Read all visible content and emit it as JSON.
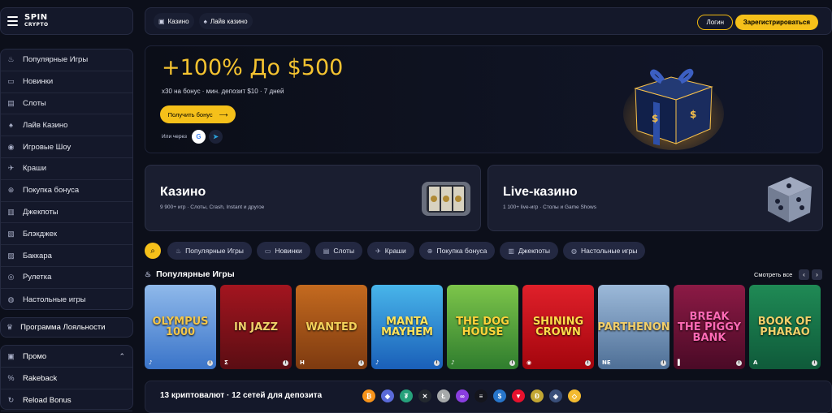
{
  "logo": {
    "line1": "SPIN",
    "line2": "CRYPTO"
  },
  "sidebar": {
    "items": [
      {
        "label": "Популярные Игры",
        "icon": "fire-icon",
        "glyph": "♨"
      },
      {
        "label": "Новинки",
        "icon": "new-icon",
        "glyph": "▭"
      },
      {
        "label": "Слоты",
        "icon": "slots-icon",
        "glyph": "▤"
      },
      {
        "label": "Лайв Казино",
        "icon": "live-icon",
        "glyph": "♠"
      },
      {
        "label": "Игровые Шоу",
        "icon": "show-icon",
        "glyph": "◉"
      },
      {
        "label": "Краши",
        "icon": "plane-icon",
        "glyph": "✈"
      },
      {
        "label": "Покупка бонуса",
        "icon": "bonus-icon",
        "glyph": "⊕"
      },
      {
        "label": "Джекпоты",
        "icon": "jackpot-icon",
        "glyph": "▥"
      },
      {
        "label": "Блэкджек",
        "icon": "cards-icon",
        "glyph": "▧"
      },
      {
        "label": "Баккара",
        "icon": "baccarat-icon",
        "glyph": "▨"
      },
      {
        "label": "Рулетка",
        "icon": "roulette-icon",
        "glyph": "◎"
      },
      {
        "label": "Настольные игры",
        "icon": "table-icon",
        "glyph": "◍"
      }
    ],
    "loyalty": {
      "label": "Программа Лояльности",
      "icon": "crown-icon",
      "glyph": "♛"
    },
    "promo": [
      {
        "label": "Промо",
        "icon": "gift-icon",
        "glyph": "▣"
      },
      {
        "label": "Rakeback",
        "icon": "percent-icon",
        "glyph": "%"
      },
      {
        "label": "Reload Bonus",
        "icon": "reload-icon",
        "glyph": "↻"
      }
    ]
  },
  "topbar": {
    "tabs": [
      {
        "label": "Казино",
        "icon": "casino-icon",
        "glyph": "▣"
      },
      {
        "label": "Лайв казино",
        "icon": "live-casino-icon",
        "glyph": "♠"
      }
    ],
    "login_label": "Логин",
    "register_label": "Зарегистрироваться"
  },
  "hero": {
    "title": "+100% До $500",
    "subtitle": "x30 на бонус · мин. депозит $10 · 7 дней",
    "button_label": "Получить бонус",
    "button_arrow": "⟶",
    "or_label": "Или через",
    "google_glyph": "G",
    "telegram_glyph": "➤"
  },
  "categories": [
    {
      "title": "Казино",
      "subtitle": "9 900+ игр · Слоты, Crash, Instant и другое"
    },
    {
      "title": "Live-казино",
      "subtitle": "1 100+ live-игр · Столы и Game Shows"
    }
  ],
  "filters": {
    "search_glyph": "⌕",
    "chips": [
      {
        "label": "Популярные Игры",
        "glyph": "♨"
      },
      {
        "label": "Новинки",
        "glyph": "▭"
      },
      {
        "label": "Слоты",
        "glyph": "▤"
      },
      {
        "label": "Краши",
        "glyph": "✈"
      },
      {
        "label": "Покупка бонуса",
        "glyph": "⊕"
      },
      {
        "label": "Джекпоты",
        "glyph": "▥"
      },
      {
        "label": "Настольные игры",
        "glyph": "◍"
      }
    ]
  },
  "games_section": {
    "title": "Популярные Игры",
    "glyph": "♨",
    "see_all": "Смотреть все",
    "prev_glyph": "‹",
    "next_glyph": "›",
    "games": [
      {
        "title": "OLYMPUS 1000",
        "provider": "♪",
        "color1": "#3a74c9",
        "color2": "#8fb9ea",
        "text": "#f3c64a"
      },
      {
        "title": "IN JAZZ",
        "provider": "Σ",
        "color1": "#5a0d13",
        "color2": "#a3151f",
        "text": "#f0d06a"
      },
      {
        "title": "WANTED",
        "provider": "H",
        "color1": "#7d3a10",
        "color2": "#c46a1f",
        "text": "#f4d25a"
      },
      {
        "title": "MANTA MAYHEM",
        "provider": "♪",
        "color1": "#1a5fb8",
        "color2": "#48b5ea",
        "text": "#ffe45c"
      },
      {
        "title": "THE DOG HOUSE",
        "provider": "♪",
        "color1": "#2f7d2e",
        "color2": "#7dc54a",
        "text": "#ffd43a"
      },
      {
        "title": "SHINING CROWN",
        "provider": "◉",
        "color1": "#a3050d",
        "color2": "#e0202a",
        "text": "#ffdc4a"
      },
      {
        "title": "PARTHENON",
        "provider": "NE",
        "color1": "#4e6f96",
        "color2": "#9cb9d9",
        "text": "#f3cf6a"
      },
      {
        "title": "BREAK THE PIGGY BANK",
        "provider": "▌",
        "color1": "#4a0a26",
        "color2": "#8c1a45",
        "text": "#ff6ab5"
      },
      {
        "title": "BOOK OF PHARAO",
        "provider": "A",
        "color1": "#0f5a3a",
        "color2": "#1f8a55",
        "text": "#f2d06a"
      }
    ]
  },
  "crypto": {
    "title": "13 криптовалют · 12 сетей для депозита",
    "coins": [
      {
        "name": "btc-icon",
        "glyph": "₿",
        "color": "#f7931a"
      },
      {
        "name": "eth-icon",
        "glyph": "◆",
        "color": "#5a6ad8"
      },
      {
        "name": "usdt-icon",
        "glyph": "₮",
        "color": "#26a17b"
      },
      {
        "name": "xrp-icon",
        "glyph": "✕",
        "color": "#23292f"
      },
      {
        "name": "ltc-icon",
        "glyph": "Ł",
        "color": "#a6a9aa"
      },
      {
        "name": "link-icon",
        "glyph": "∞",
        "color": "#8a3ee0"
      },
      {
        "name": "sol-icon",
        "glyph": "≡",
        "color": "#14151d"
      },
      {
        "name": "usdc-icon",
        "glyph": "$",
        "color": "#2775ca"
      },
      {
        "name": "tron-icon",
        "glyph": "▼",
        "color": "#e8112d"
      },
      {
        "name": "doge-icon",
        "glyph": "Ð",
        "color": "#c2a633"
      },
      {
        "name": "algo-icon",
        "glyph": "◈",
        "color": "#3a4f7a"
      },
      {
        "name": "bnb-icon",
        "glyph": "◇",
        "color": "#f3ba2f"
      }
    ]
  }
}
